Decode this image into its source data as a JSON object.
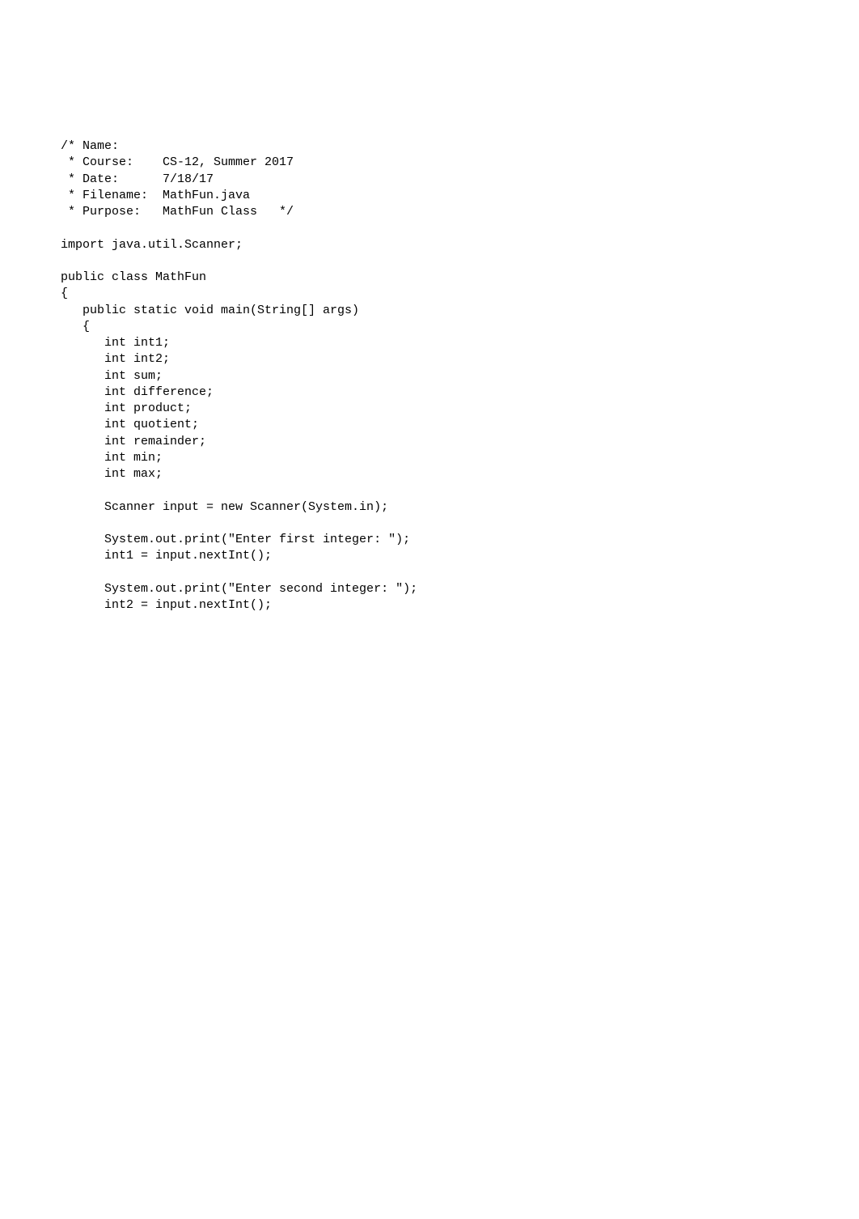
{
  "code": {
    "lines": [
      "/* Name:",
      " * Course:    CS-12, Summer 2017",
      " * Date:      7/18/17",
      " * Filename:  MathFun.java",
      " * Purpose:   MathFun Class   */",
      "",
      "import java.util.Scanner;",
      "",
      "public class MathFun",
      "{",
      "   public static void main(String[] args)",
      "   {",
      "      int int1;",
      "      int int2;",
      "      int sum;",
      "      int difference;",
      "      int product;",
      "      int quotient;",
      "      int remainder;",
      "      int min;",
      "      int max;",
      "",
      "      Scanner input = new Scanner(System.in);",
      "",
      "      System.out.print(\"Enter first integer: \");",
      "      int1 = input.nextInt();",
      "",
      "      System.out.print(\"Enter second integer: \");",
      "      int2 = input.nextInt();"
    ]
  }
}
